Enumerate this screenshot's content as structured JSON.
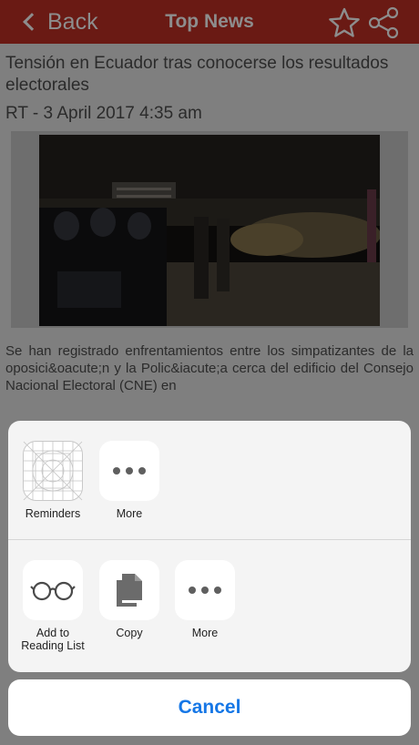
{
  "nav": {
    "back_label": "Back",
    "title": "Top News",
    "star_icon": "star-outline-icon",
    "share_icon": "share-icon"
  },
  "article": {
    "headline": "Tensión en Ecuador tras conocerse los resultados electorales",
    "byline": "RT - 3 April 2017 4:35 am",
    "body": "Se han registrado enfrentamientos entre los simpatizantes de la oposici&oacute;n y la Polic&iacute;a cerca del edificio del Consejo Nacional Electoral (CNE) en"
  },
  "share_sheet": {
    "row1": [
      {
        "label": "Reminders",
        "icon": "reminders-grid-icon"
      },
      {
        "label": "More",
        "icon": "more-dots-icon"
      }
    ],
    "row2": [
      {
        "label": "Add to Reading List",
        "icon": "glasses-icon"
      },
      {
        "label": "Copy",
        "icon": "copy-icon"
      },
      {
        "label": "More",
        "icon": "more-dots-icon"
      }
    ],
    "cancel_label": "Cancel"
  },
  "colors": {
    "nav_bar": "#6a1a14",
    "dim_overlay": "#7f7f7f",
    "cancel_text": "#1677e6"
  }
}
